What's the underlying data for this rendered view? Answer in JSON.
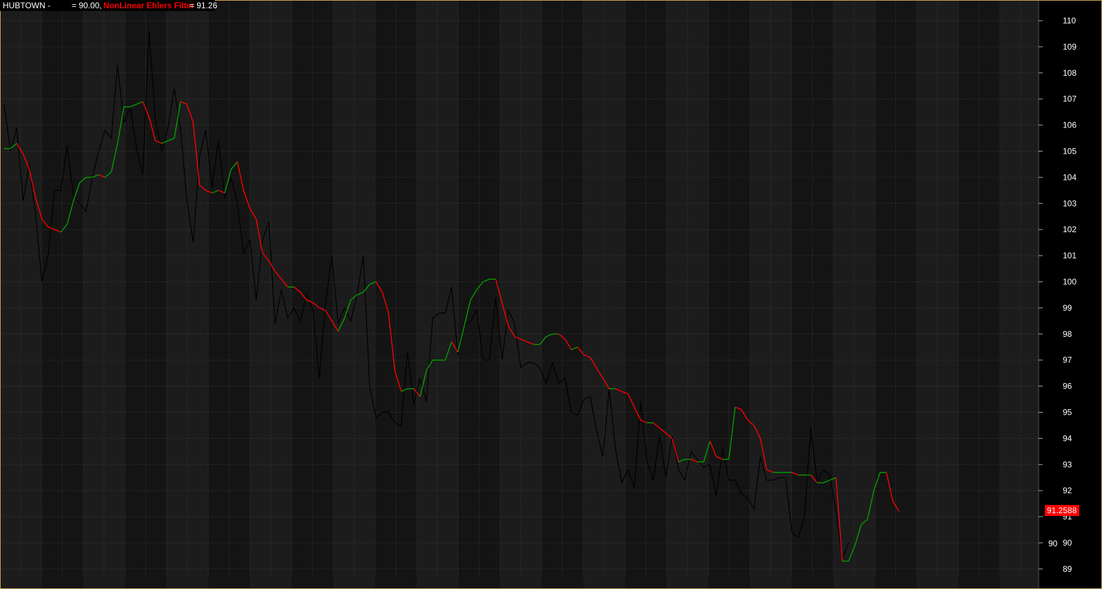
{
  "header": {
    "symbol": "HUBTOWN -",
    "price_text": "= 90.00,",
    "indicator_name": "NonLinear Ehlers Filter",
    "indicator_text": "= 91.26"
  },
  "last_value_badge": "91.2588",
  "price_label_extra": "90",
  "colors": {
    "background_a": "#1c1c1c",
    "background_b": "#141414",
    "grid": "#3a3a3a",
    "price": "#000000",
    "filter_up": "#00a000",
    "filter_down": "#ff0000",
    "badge": "#ff0000",
    "axis_text": "#ffffff",
    "border": "#c8a050"
  },
  "chart_data": {
    "type": "line",
    "ylim": [
      89,
      110.4
    ],
    "y_ticks": [
      "89",
      "90",
      "91",
      "92",
      "93",
      "94",
      "95",
      "96",
      "97",
      "98",
      "99",
      "100",
      "101",
      "102",
      "103",
      "104",
      "105",
      "106",
      "107",
      "108",
      "109",
      "110"
    ],
    "grid": true,
    "series": [
      {
        "name": "HUBTOWN",
        "values": [
          106.8,
          105,
          105.9,
          103.1,
          104.5,
          102.5,
          100,
          101,
          103.5,
          103.5,
          105.2,
          103.3,
          103,
          102.7,
          104,
          105,
          105.8,
          105.5,
          108.3,
          106.1,
          106.7,
          105.1,
          104.1,
          109.6,
          106.2,
          105,
          105.9,
          107.4,
          105.8,
          103.1,
          101.5,
          104.8,
          105.8,
          103.6,
          105.4,
          103.2,
          104,
          103,
          101.1,
          101.6,
          99.3,
          101.6,
          102.3,
          98.4,
          99.7,
          98.6,
          99,
          98.5,
          99.5,
          98.9,
          96.3,
          99.2,
          101,
          98.4,
          99,
          98.5,
          99.5,
          101,
          96,
          94.8,
          95,
          95,
          94.6,
          94.5,
          97.3,
          95.3,
          96.3,
          95.4,
          98.6,
          98.8,
          98.8,
          99.8,
          97.2,
          98.3,
          98.5,
          98.9,
          97,
          97,
          99.4,
          97,
          98.9,
          98.4,
          96.7,
          96.9,
          96.9,
          96.7,
          96.1,
          96.9,
          96.1,
          96.3,
          95,
          94.9,
          95.5,
          95.6,
          94.3,
          93.3,
          95.9,
          93.6,
          92.3,
          92.8,
          92.1,
          95.4,
          93.1,
          92.4,
          94.1,
          92.5,
          94.1,
          92.8,
          92.4,
          93.5,
          93.2,
          92.9,
          93,
          91.8,
          93.6,
          92.4,
          92.4,
          91.9,
          91.7,
          91.3,
          93.3,
          92.4,
          92.4,
          92.5,
          92.5,
          90.4,
          90.2,
          91,
          94.4,
          92.3,
          92.8,
          92.6,
          91.2,
          89.4,
          90
        ]
      },
      {
        "name": "NonLinear Ehlers Filter",
        "values": [
          105.1,
          105.1,
          105.3,
          104.9,
          104.3,
          103.2,
          102.4,
          102.1,
          102,
          101.9,
          102.2,
          103.1,
          103.8,
          104,
          104,
          104.1,
          104,
          104.2,
          105.3,
          106.7,
          106.7,
          106.8,
          106.9,
          106.3,
          105.4,
          105.3,
          105.4,
          105.5,
          106.9,
          106.8,
          106.1,
          103.7,
          103.5,
          103.4,
          103.5,
          103.4,
          104.3,
          104.6,
          103.5,
          102.8,
          102.4,
          101.1,
          100.8,
          100.4,
          100.1,
          99.8,
          99.8,
          99.6,
          99.3,
          99.2,
          99,
          98.9,
          98.5,
          98.1,
          98.6,
          99.3,
          99.5,
          99.6,
          99.9,
          100,
          99.6,
          98.8,
          96.6,
          95.8,
          95.9,
          95.9,
          95.6,
          96.6,
          97,
          97,
          97,
          97.7,
          97.3,
          98.3,
          99.3,
          99.7,
          100,
          100.1,
          100.1,
          99.2,
          98.3,
          97.9,
          97.8,
          97.7,
          97.6,
          97.6,
          97.9,
          98,
          98,
          97.8,
          97.4,
          97.5,
          97.2,
          97.1,
          96.7,
          96.3,
          95.9,
          95.9,
          95.8,
          95.7,
          95.2,
          94.7,
          94.6,
          94.6,
          94.4,
          94.2,
          94,
          93.1,
          93.2,
          93.2,
          93.1,
          93.1,
          93.9,
          93.3,
          93.2,
          93.2,
          95.2,
          95.1,
          94.7,
          94.5,
          94,
          92.8,
          92.7,
          92.7,
          92.7,
          92.7,
          92.6,
          92.6,
          92.6,
          92.3,
          92.3,
          92.4,
          92.5,
          89.3,
          89.3,
          89.9,
          90.7,
          90.9,
          92,
          92.7,
          92.7,
          91.6,
          91.2
        ]
      }
    ]
  }
}
